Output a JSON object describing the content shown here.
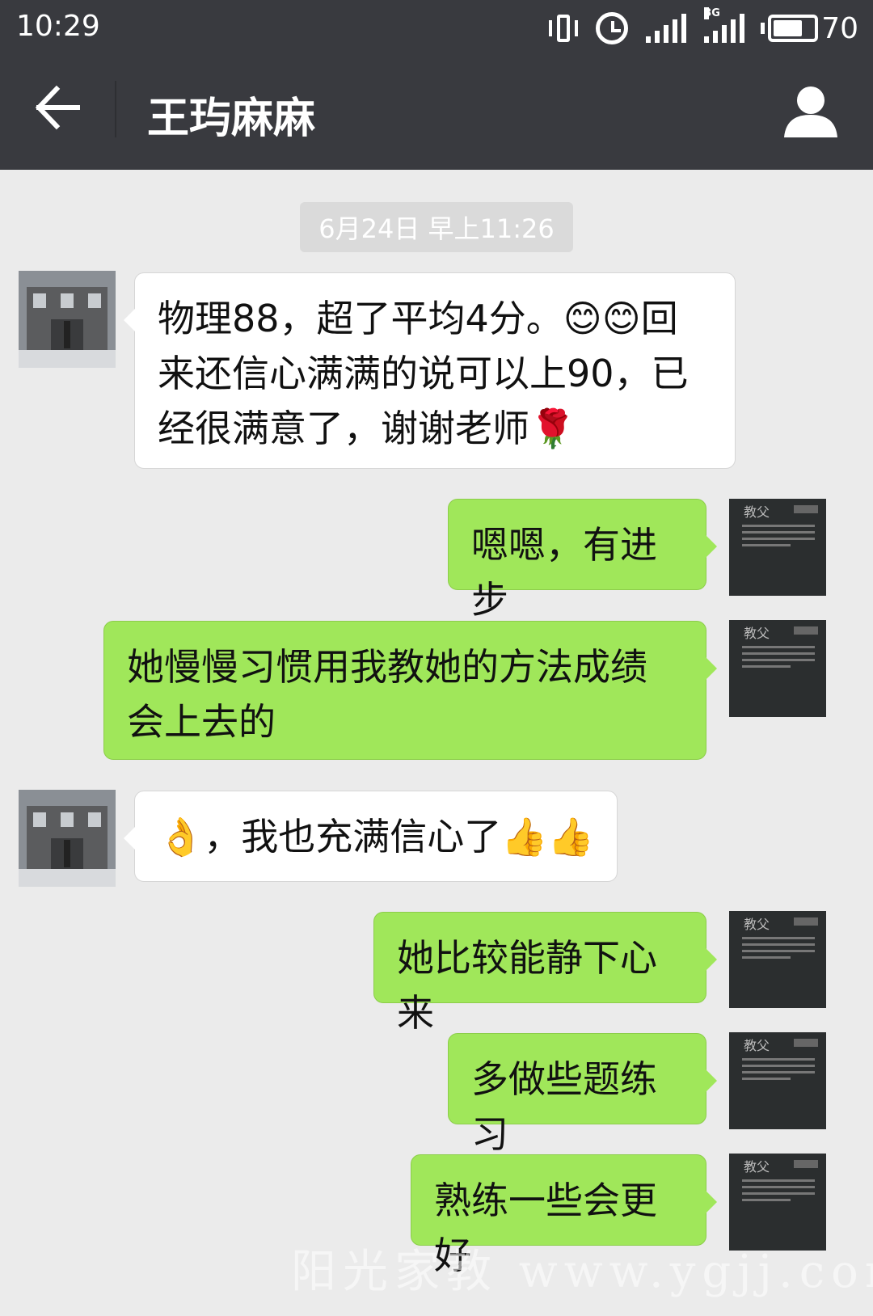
{
  "status_bar": {
    "time": "10:29",
    "network_label": "3G",
    "battery": "70",
    "battery_level": 0.7,
    "icons": [
      "vibrate-icon",
      "alarm-icon",
      "signal-icon",
      "signal-3g-icon",
      "battery-icon"
    ]
  },
  "header": {
    "title": "王玙麻麻",
    "back_icon": "arrow-left-icon",
    "profile_icon": "person-icon"
  },
  "timestamp": "6月24日 早上11:26",
  "messages": [
    {
      "side": "in",
      "text": "物理88，超了平均4分。😊😊回来还信心满满的说可以上90，已经很满意了，谢谢老师🌹"
    },
    {
      "side": "out",
      "text": "嗯嗯，有进步"
    },
    {
      "side": "out",
      "text": "她慢慢习惯用我教她的方法成绩会上去的"
    },
    {
      "side": "in",
      "text": "👌，我也充满信心了👍👍"
    },
    {
      "side": "out",
      "text": "她比较能静下心来"
    },
    {
      "side": "out",
      "text": "多做些题练习"
    },
    {
      "side": "out",
      "text": "熟练一些会更好"
    }
  ],
  "teacher_avatar_text": "教父",
  "watermark": "阳光家教 www.ygjj.com",
  "colors": {
    "topbar": "#393a3f",
    "background": "#ebebeb",
    "outgoing_bubble": "#a0e75a",
    "incoming_bubble": "#ffffff"
  }
}
